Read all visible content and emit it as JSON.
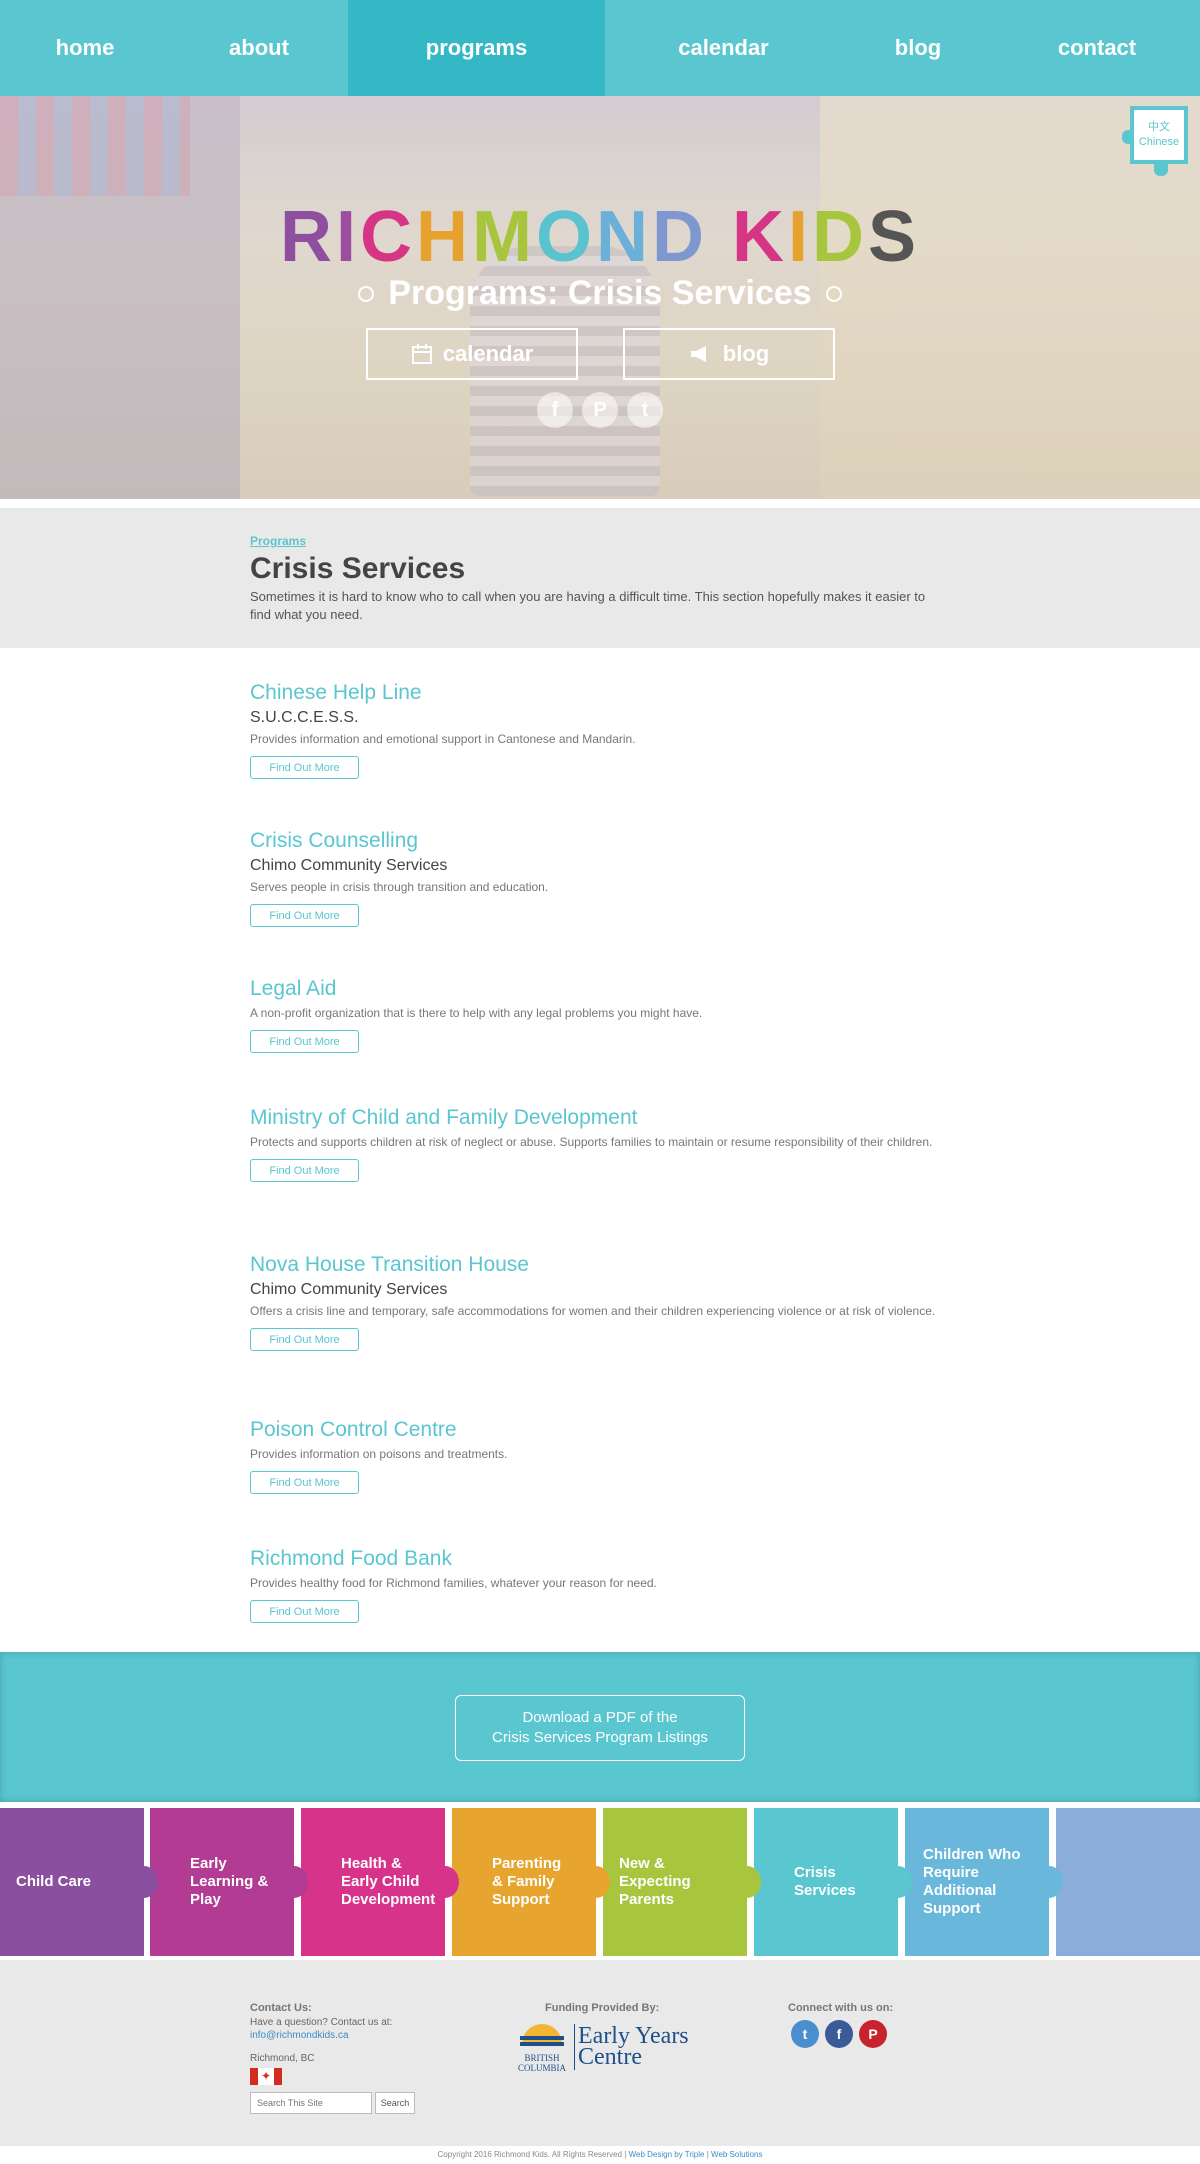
{
  "nav": {
    "items": [
      {
        "label": "home"
      },
      {
        "label": "about"
      },
      {
        "label": "programs"
      },
      {
        "label": "calendar"
      },
      {
        "label": "blog"
      },
      {
        "label": "contact"
      }
    ]
  },
  "hero": {
    "brand_letters": [
      "R",
      "I",
      "C",
      "H",
      "M",
      "O",
      "N",
      "D",
      " ",
      "K",
      "I",
      "D",
      "S"
    ],
    "subtitle": "Programs: Crisis Services",
    "calendar_label": "calendar",
    "blog_label": "blog",
    "social": [
      {
        "icon": "facebook-icon",
        "glyph": "f"
      },
      {
        "icon": "pinterest-icon",
        "glyph": "P"
      },
      {
        "icon": "twitter-icon",
        "glyph": "t"
      }
    ]
  },
  "language": {
    "native": "中文",
    "label": "Chinese"
  },
  "intro": {
    "breadcrumb": "Programs",
    "title": "Crisis Services",
    "text": "Sometimes it is hard to know who to call when you are having a difficult time. This section hopefully makes it easier to find what you need."
  },
  "listings": [
    {
      "name": "Chinese Help Line",
      "org": "S.U.C.C.E.S.S.",
      "desc": "Provides information and emotional support in Cantonese and Mandarin.",
      "button": "Find Out More"
    },
    {
      "name": "Crisis Counselling",
      "org": "Chimo Community Services",
      "desc": "Serves people in crisis through transition and education.",
      "button": "Find Out More"
    },
    {
      "name": "Legal Aid",
      "org": "",
      "desc": "A non-profit organization that is there to help with any legal problems you might have.",
      "button": "Find Out More"
    },
    {
      "name": "Ministry of Child and Family Development",
      "org": "",
      "desc": "Protects and supports children at risk of neglect or abuse. Supports families to maintain or resume responsibility of their children.",
      "button": "Find Out More"
    },
    {
      "name": "Nova House Transition House",
      "org": "Chimo Community Services",
      "desc": "Offers a crisis line and temporary, safe accommodations for women and their children experiencing violence or at risk of violence.",
      "button": "Find Out More"
    },
    {
      "name": "Poison Control Centre",
      "org": "",
      "desc": "Provides information on poisons and treatments.",
      "button": "Find Out More"
    },
    {
      "name": "Richmond Food Bank",
      "org": "",
      "desc": "Provides healthy food for Richmond families, whatever your reason for need.",
      "button": "Find Out More"
    }
  ],
  "pdf": {
    "line1": "Download a PDF of the",
    "line2": "Crisis Services Program Listings"
  },
  "tiles": [
    {
      "label": "Child Care",
      "color": "#8a4f9e"
    },
    {
      "label": "Early Learning & Play",
      "color": "#b23b93"
    },
    {
      "label": "Health & Early Child Development",
      "color": "#d7338a"
    },
    {
      "label": "Parenting & Family Support",
      "color": "#e7a530"
    },
    {
      "label": "New & Expecting Parents",
      "color": "#a7c63e"
    },
    {
      "label": "Crisis Services",
      "color": "#5ac6d0"
    },
    {
      "label": "Children Who Require Additional Support",
      "color": "#6ab7dc"
    },
    {
      "label": "",
      "color": "#8aaed9"
    }
  ],
  "footer": {
    "contact_heading": "Contact Us:",
    "contact_text": "Have a question? Contact us at:",
    "email": "info@richmondkids.ca",
    "location": "Richmond, BC",
    "search_placeholder": "Search This Site",
    "search_button": "Search",
    "funding_heading": "Funding Provided By:",
    "bc_line1": "BRITISH",
    "bc_line2": "COLUMBIA",
    "eyc_line1": "Early Years",
    "eyc_line2": "Centre",
    "connect_heading": "Connect with us on:",
    "social": [
      {
        "icon": "twitter-icon",
        "glyph": "t",
        "color": "#4a8ed0"
      },
      {
        "icon": "facebook-icon",
        "glyph": "f",
        "color": "#3a5a98"
      },
      {
        "icon": "pinterest-icon",
        "glyph": "P",
        "color": "#c8232c"
      }
    ]
  },
  "copyright": {
    "text": "Copyright 2016 Richmond Kids. All Rights Reserved |",
    "credit1": "Web Design by Triple",
    "sep": "|",
    "credit2": "Web Solutions"
  }
}
